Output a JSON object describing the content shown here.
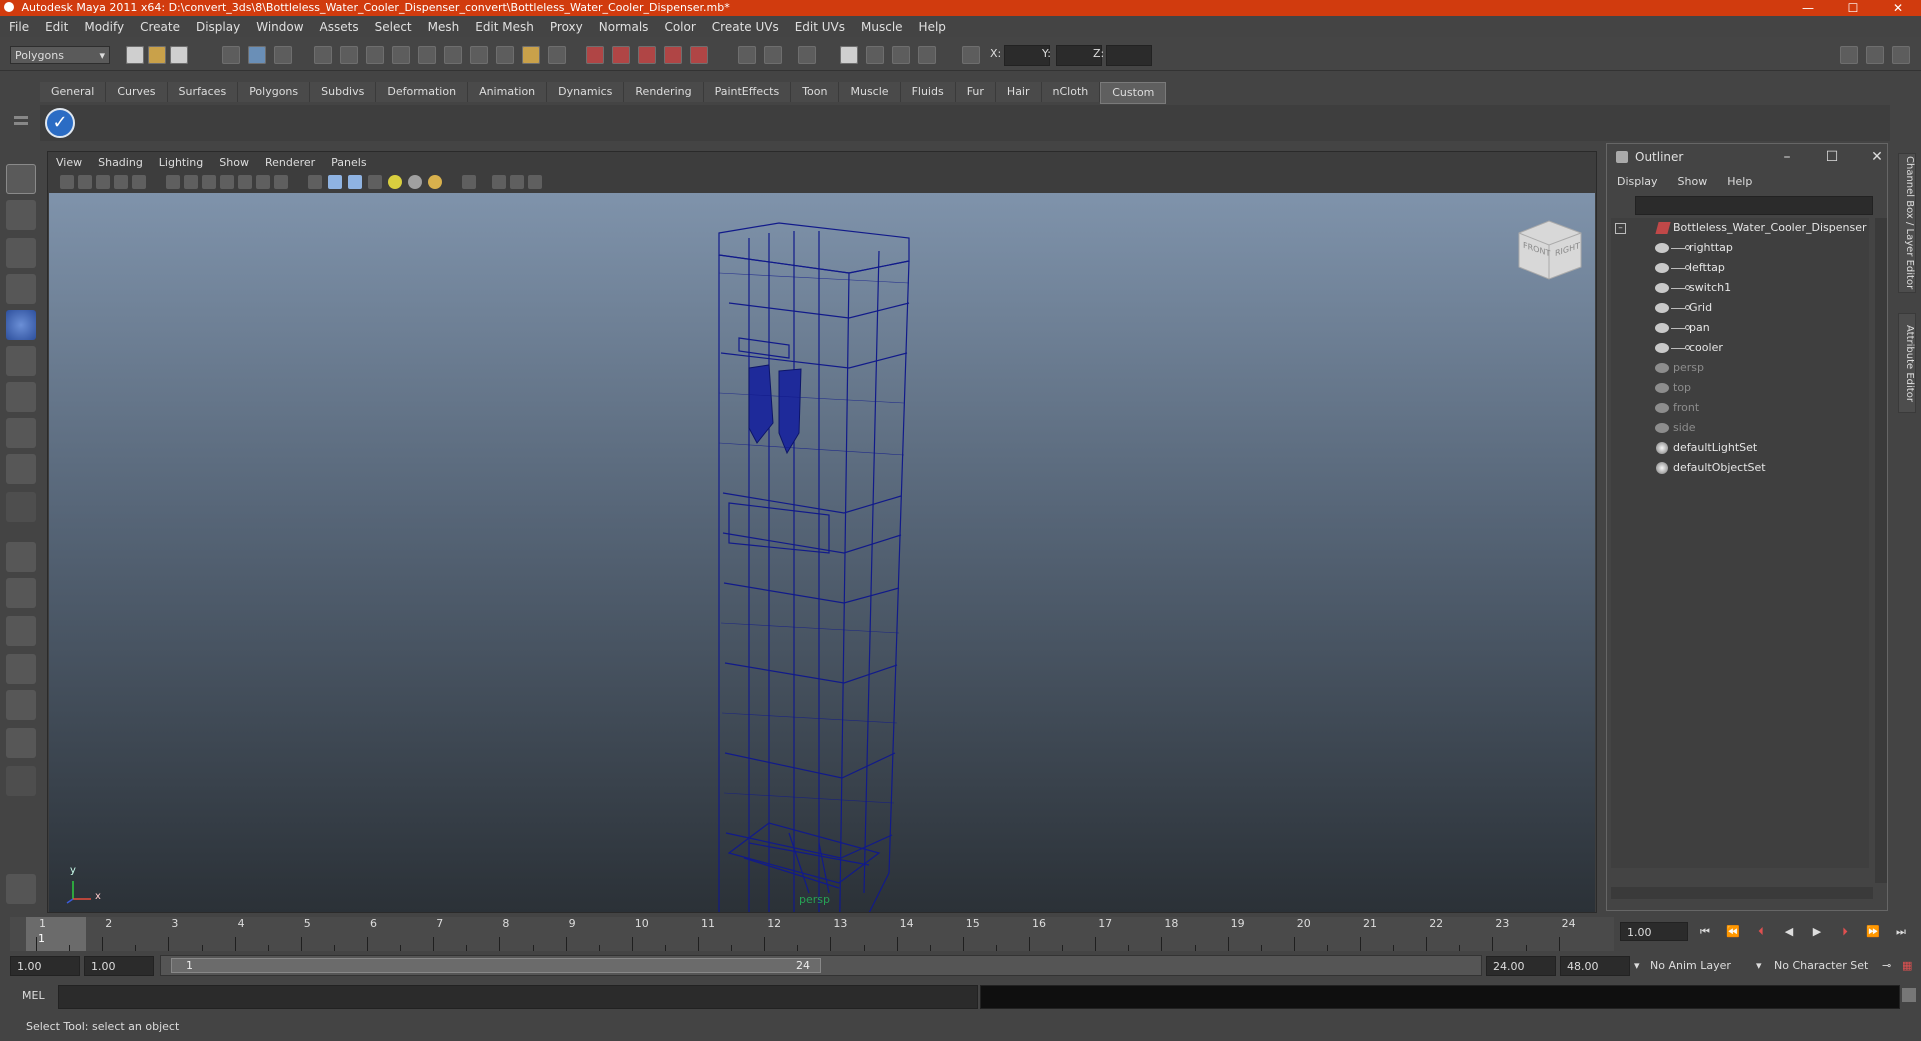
{
  "app": {
    "title": "Autodesk Maya 2011 x64: D:\\convert_3ds\\8\\Bottleless_Water_Cooler_Dispenser_convert\\Bottleless_Water_Cooler_Dispenser.mb*",
    "accent": "#d13b0e"
  },
  "menus": [
    "File",
    "Edit",
    "Modify",
    "Create",
    "Display",
    "Window",
    "Assets",
    "Select",
    "Mesh",
    "Edit Mesh",
    "Proxy",
    "Normals",
    "Color",
    "Create UVs",
    "Edit UVs",
    "Muscle",
    "Help"
  ],
  "status": {
    "mode": "Polygons",
    "x_label": "X:",
    "y_label": "Y:",
    "z_label": "Z:"
  },
  "shelf": {
    "tabs": [
      "General",
      "Curves",
      "Surfaces",
      "Polygons",
      "Subdivs",
      "Deformation",
      "Animation",
      "Dynamics",
      "Rendering",
      "PaintEffects",
      "Toon",
      "Muscle",
      "Fluids",
      "Fur",
      "Hair",
      "nCloth",
      "Custom"
    ],
    "active": "Custom"
  },
  "viewport": {
    "menu": [
      "View",
      "Shading",
      "Lighting",
      "Show",
      "Renderer",
      "Panels"
    ],
    "camera": "persp",
    "cube_front": "FRONT",
    "cube_right": "RIGHT",
    "axis_y": "y",
    "axis_x": "x"
  },
  "outliner": {
    "title": "Outliner",
    "menu": [
      "Display",
      "Show",
      "Help"
    ],
    "root": "Bottleless_Water_Cooler_Dispenser",
    "children": [
      "righttap",
      "lefttap",
      "switch1",
      "Grid",
      "pan",
      "cooler"
    ],
    "cameras": [
      "persp",
      "top",
      "front",
      "side"
    ],
    "sets": [
      "defaultLightSet",
      "defaultObjectSet"
    ]
  },
  "right_tabs": {
    "channel": "Channel Box / Layer Editor",
    "attribute": "Attribute Editor"
  },
  "timeline": {
    "ticks": [
      "1",
      "2",
      "3",
      "4",
      "5",
      "6",
      "7",
      "8",
      "9",
      "10",
      "11",
      "12",
      "13",
      "14",
      "15",
      "16",
      "17",
      "18",
      "19",
      "20",
      "21",
      "22",
      "23",
      "24"
    ],
    "current_marker": "1",
    "current_frame": "1.00"
  },
  "range": {
    "start": "1.00",
    "playback_start": "1.00",
    "bar_start": "1",
    "bar_end": "24",
    "playback_end": "24.00",
    "end": "48.00",
    "anim_layer": "No Anim Layer",
    "character_set": "No Character Set"
  },
  "command": {
    "label": "MEL"
  },
  "help": {
    "text": "Select Tool: select an object"
  }
}
